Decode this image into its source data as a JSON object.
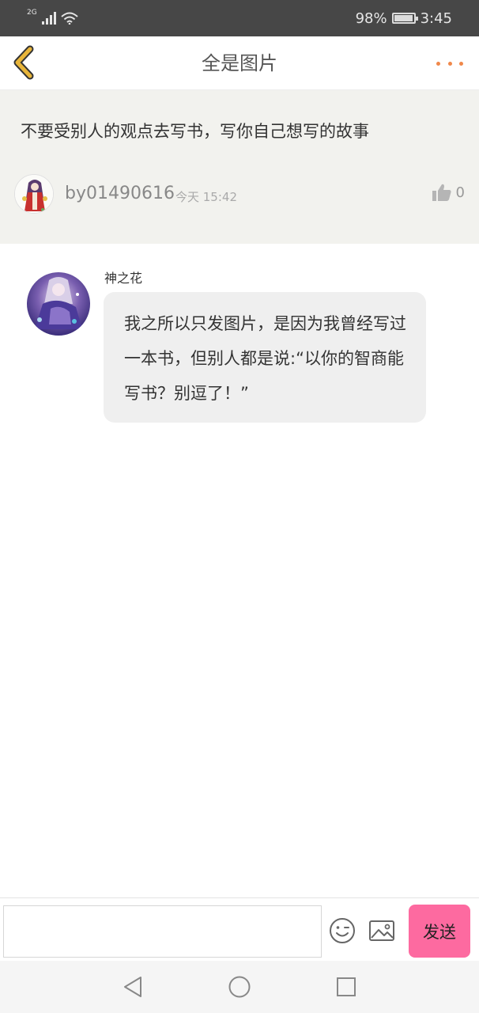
{
  "status_bar": {
    "network": "2G",
    "battery_percent": "98%",
    "battery_level": 0.98,
    "time": "3:45",
    "icons": [
      "signal-icon",
      "wifi-icon",
      "battery-icon"
    ]
  },
  "header": {
    "title": "全是图片",
    "back_icon": "chevron-left-icon",
    "more_icon": "more-dots-icon",
    "accent_back": "#e8b53a",
    "accent_more": "#f0884a"
  },
  "post": {
    "text": "不要受别人的观点去写书，写你自己想写的故事",
    "author": "by01490616",
    "time": "今天 15:42",
    "likes": "0",
    "like_icon": "thumbs-up-icon"
  },
  "comment": {
    "name": "神之花",
    "text": "我之所以只发图片，是因为我曾经写过一本书，但别人都是说:“以你的智商能写书？别逗了！”"
  },
  "input_bar": {
    "placeholder": "",
    "emoji_icon": "smiley-icon",
    "image_icon": "image-icon",
    "send_label": "发送",
    "send_color": "#fd6aa0"
  },
  "nav_bar": {
    "icons": [
      "nav-back-icon",
      "nav-home-icon",
      "nav-recent-icon"
    ]
  }
}
